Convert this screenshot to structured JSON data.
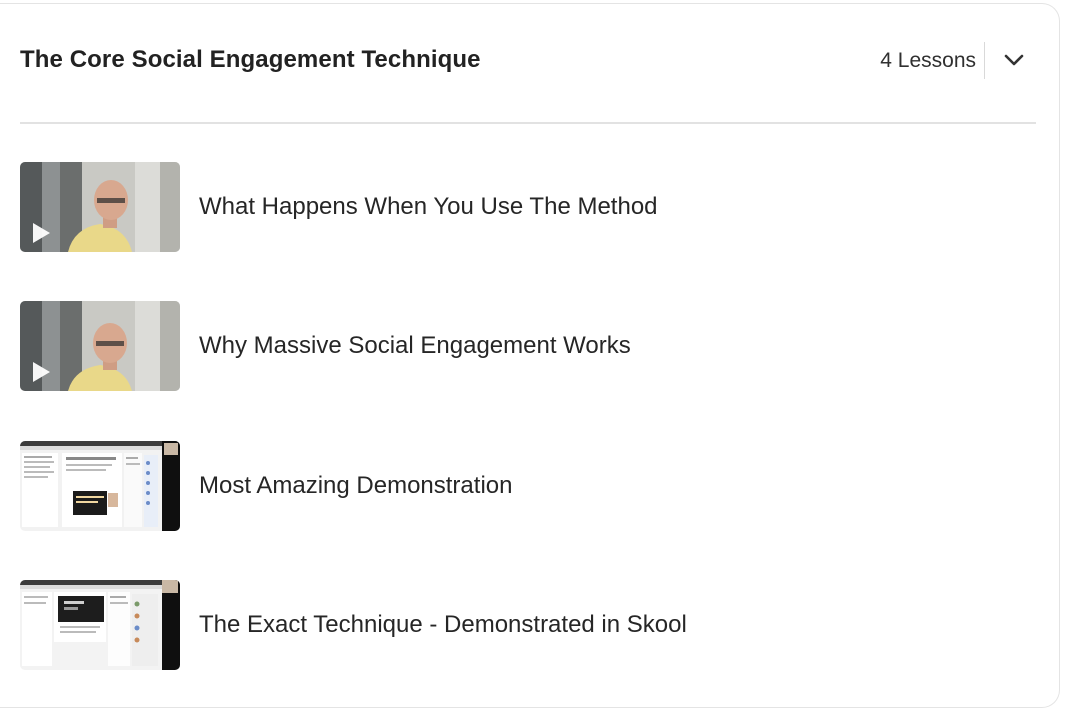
{
  "section": {
    "title": "The Core Social Engagement Technique",
    "lessons_count": "4 Lessons",
    "toggle_icon": "chevron-down-icon"
  },
  "lessons": [
    {
      "title": "What Happens When You Use The Method",
      "thumbnail": "presenter-video-thumbnail"
    },
    {
      "title": "Why Massive Social Engagement Works",
      "thumbnail": "presenter-video-thumbnail"
    },
    {
      "title": "Most Amazing Demonstration",
      "thumbnail": "screen-recording-thumbnail"
    },
    {
      "title": "The Exact Technique - Demonstrated in Skool",
      "thumbnail": "screen-recording-thumbnail"
    }
  ],
  "colors": {
    "title_text": "#222222",
    "body_text": "#262626",
    "divider": "#e2e2e2",
    "card_border": "#e4e4e4"
  }
}
